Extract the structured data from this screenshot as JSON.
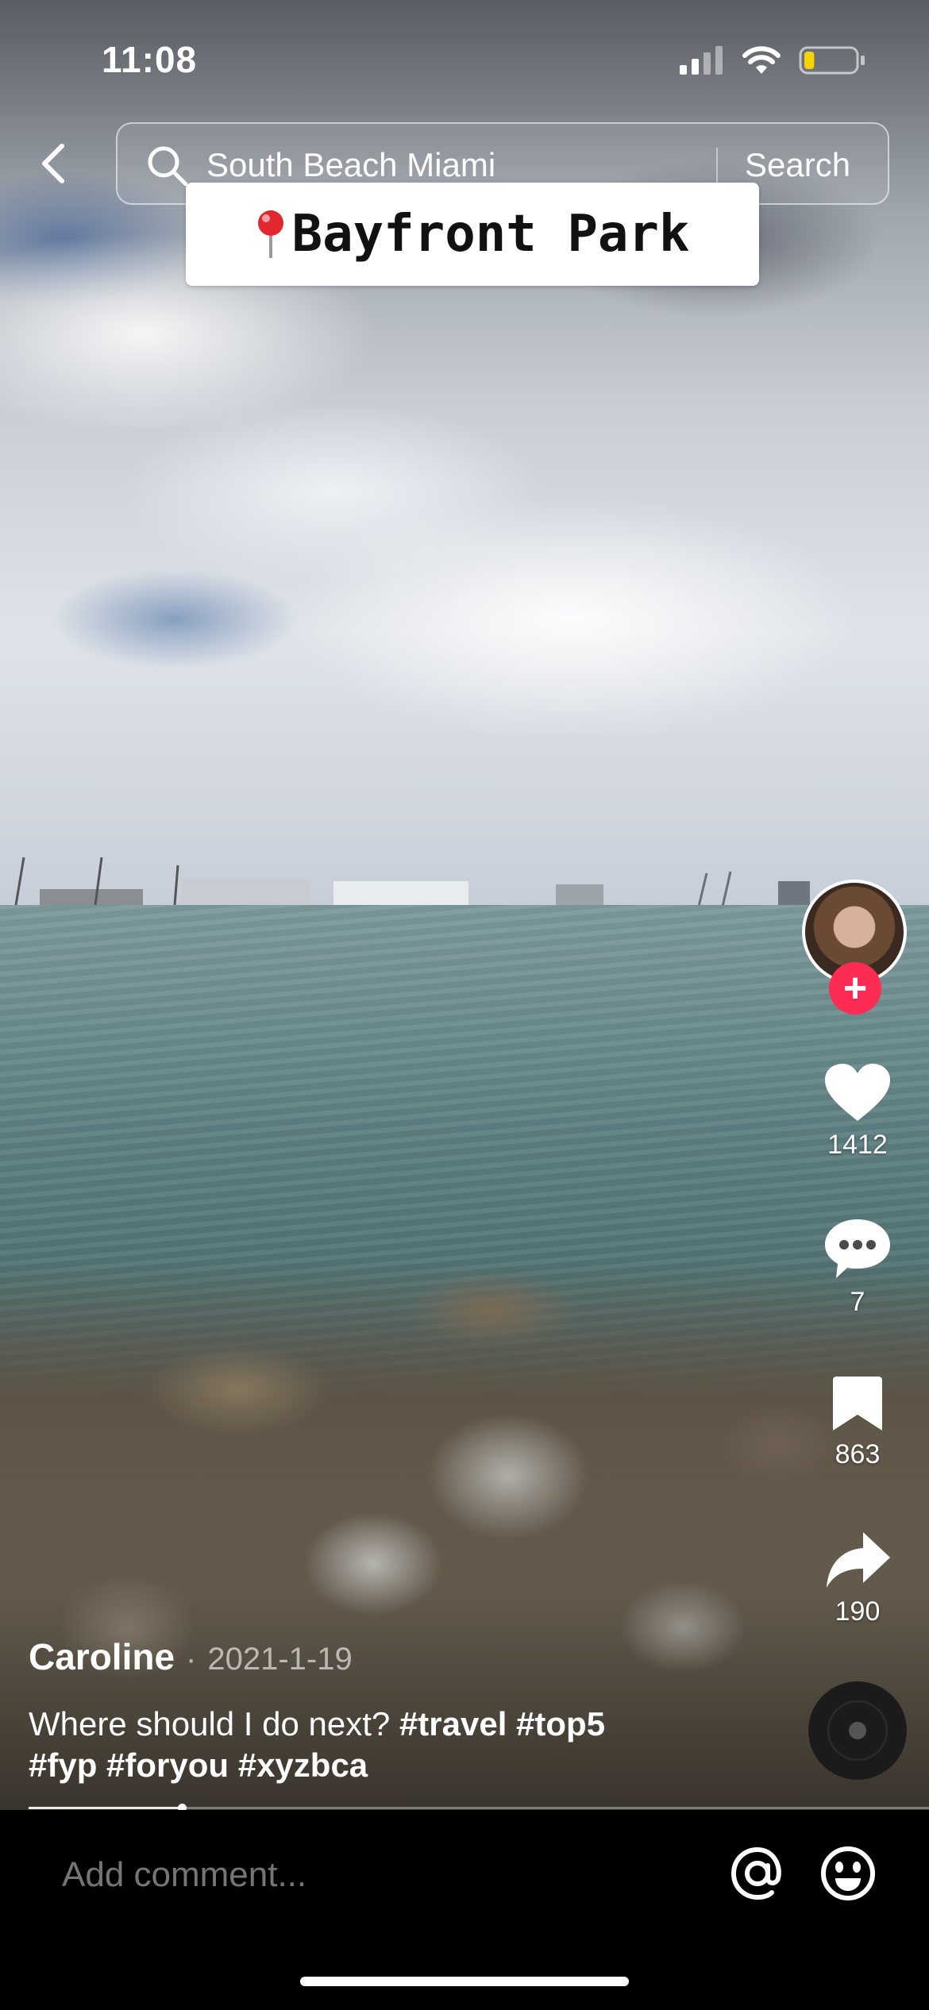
{
  "status_bar": {
    "time": "11:08",
    "battery_level": 0.2,
    "battery_color": "#f4d300"
  },
  "search": {
    "query": "South Beach Miami",
    "button_label": "Search"
  },
  "location_tag": {
    "icon": "pin-icon",
    "text": "Bayfront Park"
  },
  "actions": {
    "likes": "1412",
    "comments": "7",
    "saves": "863",
    "shares": "190"
  },
  "post": {
    "author": "Caroline",
    "separator": "·",
    "date": "2021-1-19",
    "caption_text": "Where should I do next?",
    "hashtags_line1": "#travel #top5",
    "hashtags_line2": "#fyp #foryou #xyzbca"
  },
  "video_progress": 0.17,
  "comment_bar": {
    "placeholder": "Add comment..."
  },
  "colors": {
    "follow_accent": "#fe2c55",
    "background": "#000000"
  }
}
